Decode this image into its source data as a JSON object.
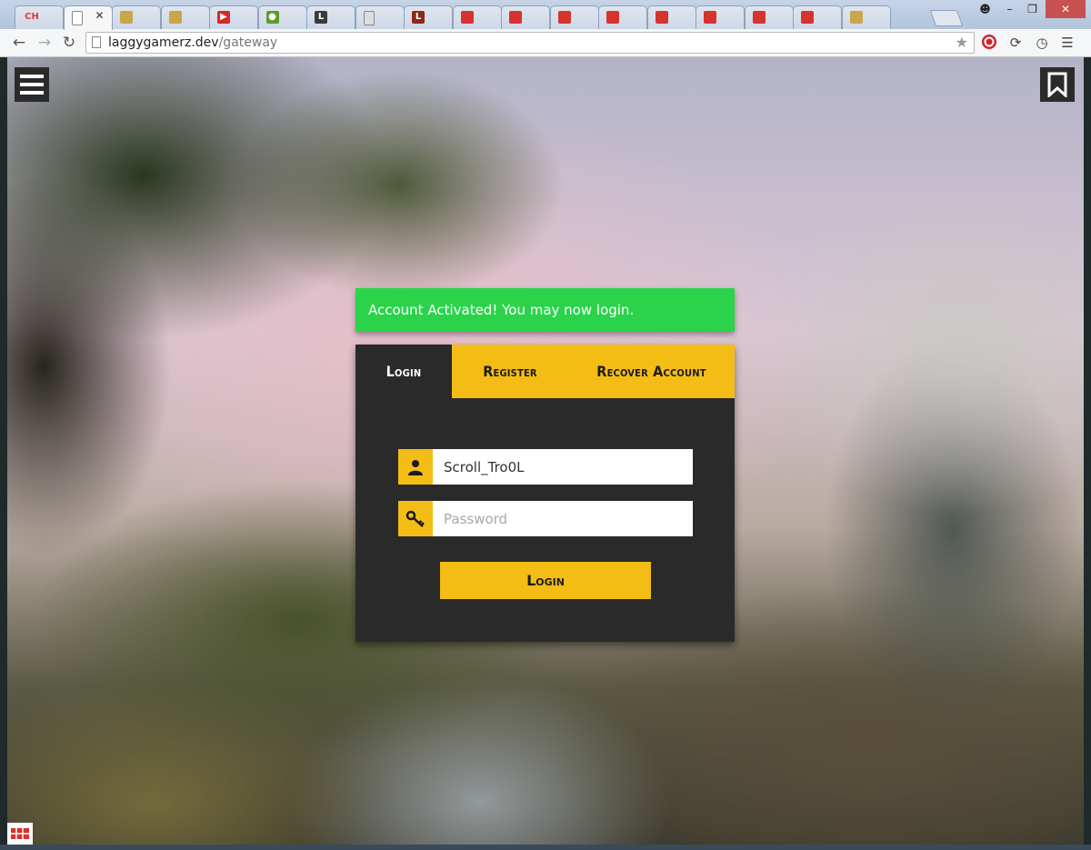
{
  "browser": {
    "tabs": [
      {
        "icon": "ch-logo-icon",
        "text": "CH",
        "color": "#e8343c",
        "active": false
      },
      {
        "icon": "page-icon",
        "text": "",
        "color": "#ffffff",
        "active": true
      },
      {
        "icon": "scroll-icon",
        "text": "",
        "color": "#c9a64a",
        "active": false
      },
      {
        "icon": "scroll-icon",
        "text": "",
        "color": "#c9a64a",
        "active": false
      },
      {
        "icon": "youtube-icon",
        "text": "▶",
        "color": "#d62828",
        "active": false
      },
      {
        "icon": "green-dot-icon",
        "text": "●",
        "color": "#5c9c2a",
        "active": false
      },
      {
        "icon": "l-logo-icon",
        "text": "L",
        "color": "#3a3a3a",
        "active": false
      },
      {
        "icon": "page-icon",
        "text": "",
        "color": "#dddddd",
        "active": false
      },
      {
        "icon": "l-logo-icon",
        "text": "L",
        "color": "#8a2a1a",
        "active": false
      },
      {
        "icon": "red-box-icon",
        "text": "",
        "color": "#d6332c",
        "active": false
      },
      {
        "icon": "red-box-icon",
        "text": "",
        "color": "#d6332c",
        "active": false
      },
      {
        "icon": "red-box-icon",
        "text": "",
        "color": "#d6332c",
        "active": false
      },
      {
        "icon": "red-box-icon",
        "text": "",
        "color": "#d6332c",
        "active": false
      },
      {
        "icon": "red-box-icon",
        "text": "",
        "color": "#d6332c",
        "active": false
      },
      {
        "icon": "red-box-icon",
        "text": "",
        "color": "#d6332c",
        "active": false
      },
      {
        "icon": "red-box-icon",
        "text": "",
        "color": "#d6332c",
        "active": false
      },
      {
        "icon": "red-box-icon",
        "text": "",
        "color": "#d6332c",
        "active": false
      },
      {
        "icon": "scroll-icon",
        "text": "",
        "color": "#c9a64a",
        "active": false
      }
    ],
    "url_host": "laggygamerz.dev",
    "url_path": "/gateway"
  },
  "page": {
    "alert": "Account Activated! You may now login.",
    "tabs": [
      "Login",
      "Register",
      "Recover Account"
    ],
    "username_value": "Scroll_Tro0L",
    "password_placeholder": "Password",
    "submit_label": "Login"
  },
  "colors": {
    "accent": "#f4bd15",
    "panel": "#2a2a2a",
    "success": "#2bd34a"
  }
}
